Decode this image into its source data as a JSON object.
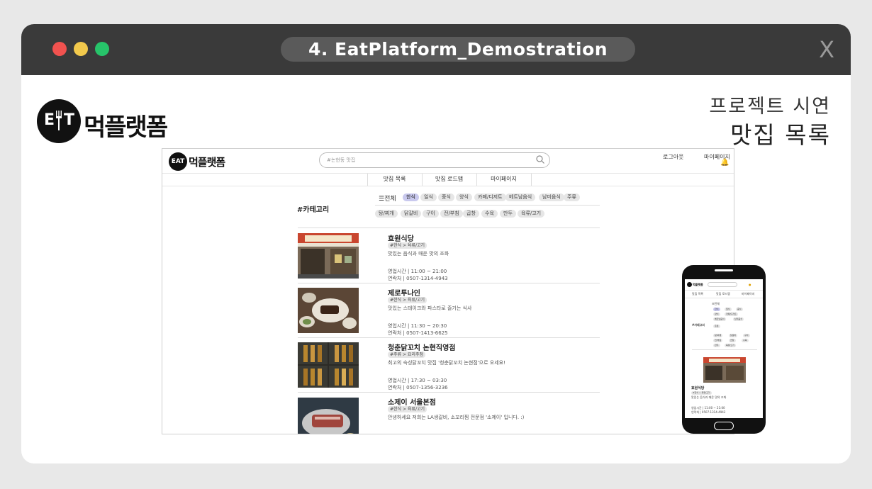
{
  "window": {
    "title": "4. EatPlatform_Demostration",
    "close_label": "X"
  },
  "brand": {
    "logo_letters_left": "E",
    "logo_letters_right": "T",
    "logo_text": "먹플랫폼"
  },
  "project": {
    "subtitle": "프로젝트 시연",
    "title": "맛집 목록"
  },
  "desktop": {
    "logo_text": "먹플랫폼",
    "search_placeholder": "#논현동 맛집",
    "logout": "로그아웃",
    "mypage": "마이페이지",
    "nav": [
      "맛집 목록",
      "맛집 로드맵",
      "마이페이지"
    ],
    "category_label": "#카테고리",
    "all_label": "☰전체",
    "chips_row1": [
      "한식",
      "일식",
      "중식",
      "양식",
      "카페/디저트",
      "베트남음식",
      "남미음식",
      "주류"
    ],
    "chips_row2": [
      "탕/찌개",
      "닭갈비",
      "구이",
      "전/부침",
      "곱창",
      "수육",
      "만두",
      "육류/고기"
    ],
    "restaurants": [
      {
        "name": "효원식당",
        "tags": "#한식 > 육류/고기",
        "desc": "맛있는 음식과 매운 맛의 조화",
        "hours": "영업시간 | 11:00 ~ 21:00",
        "phone": "연락처 | 0507-1314-4943"
      },
      {
        "name": "제로투나인",
        "tags": "#한식 > 육류/고기",
        "desc": "맛있는 스테이크와 파스타로 즐기는 식사",
        "hours": "영업시간 | 11:30 ~ 20:30",
        "phone": "연락처 | 0507-1413-6625"
      },
      {
        "name": "청춘닭꼬치 논현직영점",
        "tags": "#주류 > 요리주점",
        "desc": "최고의 숙성닭꼬치 맛집 '청춘닭꼬치 논현점'으로 오세요!",
        "hours": "영업시간 | 17:30 ~ 03:30",
        "phone": "연락처 | 0507-1356-3236"
      },
      {
        "name": "소제이 서울본점",
        "tags": "#한식 > 육류/고기",
        "desc": "안녕하세요 저희는 LA생갈비, 소꼬리찜 전문점 '소제이' 입니다. :)",
        "hours": "",
        "phone": ""
      }
    ]
  },
  "mobile": {
    "logo_text": "먹플랫폼",
    "nav": [
      "맛집 목록",
      "맛집 로드맵",
      "마이페이지"
    ],
    "all_label": "☰전체",
    "category_label": "#카테고리",
    "chips_a": [
      "한식",
      "일식",
      "중식",
      "양식",
      "카페/디저트",
      "베트남음식",
      "남미음식",
      "주류"
    ],
    "chips_b": [
      "탕/찌개",
      "닭갈비",
      "구이",
      "전/부침",
      "곱창",
      "수육",
      "만두",
      "육류/고기"
    ],
    "first": {
      "name": "효원식당",
      "tags": "#한식 > 육류/고기",
      "desc": "맛있는 음식과 매운 맛의 조화",
      "hours": "영업시간 | 11:00 ~ 21:00",
      "phone": "연락처 | 0507-1314-4943"
    }
  },
  "colors": {
    "titlebar": "#3a3a3a",
    "dot_red": "#f1524f",
    "dot_yellow": "#f2c94c",
    "dot_green": "#27c46a",
    "chip_active": "#c9c9ee"
  },
  "icons": [
    "search-icon",
    "bell-icon",
    "fork-icon"
  ]
}
